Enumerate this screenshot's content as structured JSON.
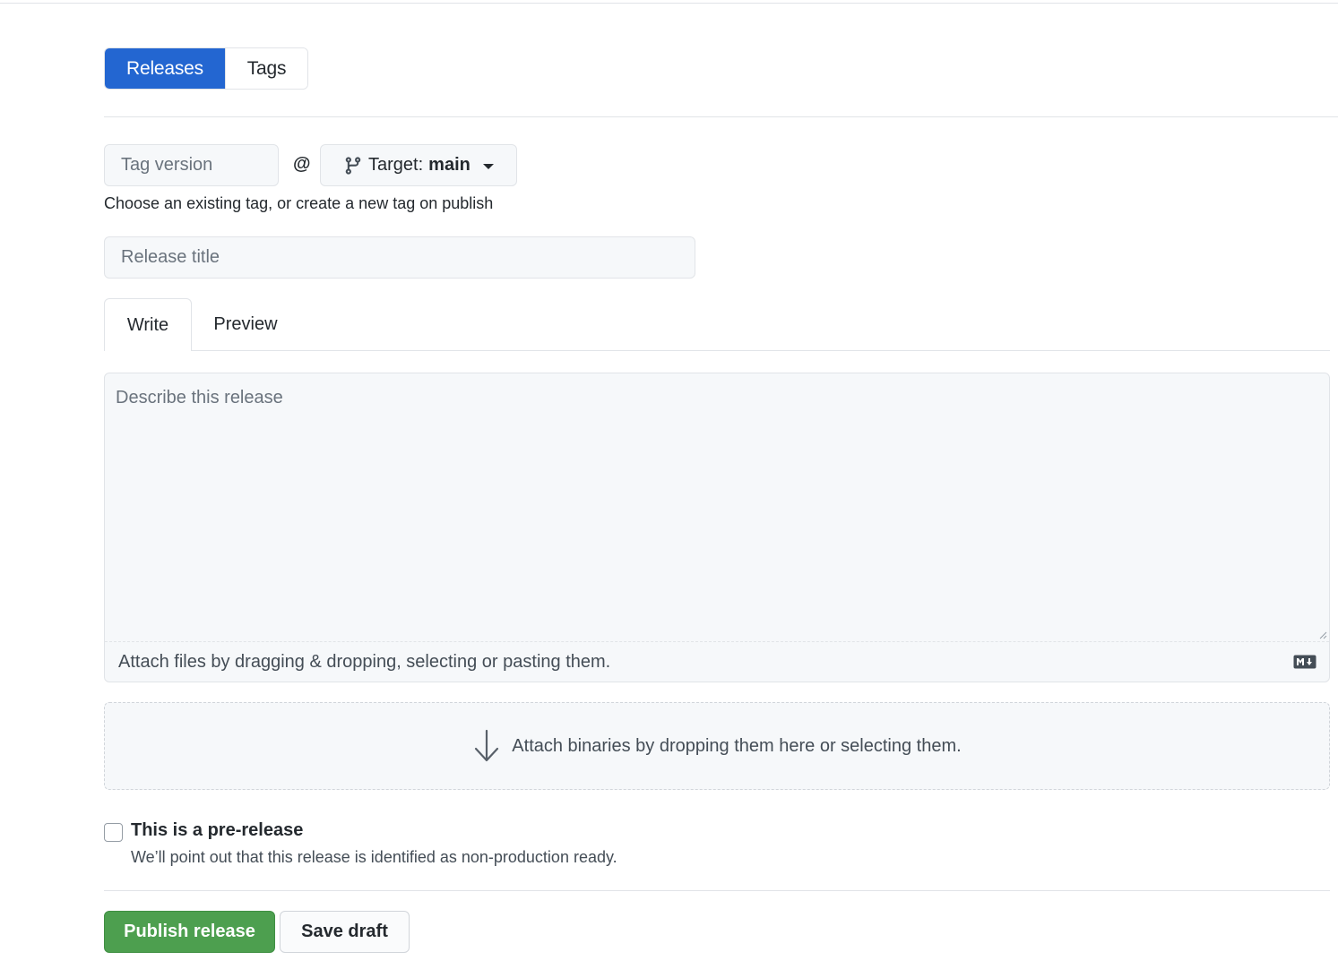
{
  "tabs_top": {
    "releases_label": "Releases",
    "tags_label": "Tags",
    "active": "Releases"
  },
  "tag": {
    "placeholder": "Tag version",
    "value": "",
    "at": "@",
    "target_label": "Target:",
    "target_value": "main",
    "helper": "Choose an existing tag, or create a new tag on publish"
  },
  "title": {
    "placeholder": "Release title",
    "value": ""
  },
  "editor_tabs": {
    "write_label": "Write",
    "preview_label": "Preview",
    "active": "Write"
  },
  "editor": {
    "placeholder": "Describe this release",
    "value": "",
    "attach_text": "Attach files by dragging & dropping, selecting or pasting them.",
    "markdown_icon": "markdown-icon"
  },
  "dropzone": {
    "text": "Attach binaries by dropping them here or selecting them.",
    "icon": "arrow-down-icon"
  },
  "prerelease": {
    "checked": false,
    "label": "This is a pre-release",
    "note": "We’ll point out that this release is identified as non-production ready."
  },
  "actions": {
    "publish_label": "Publish release",
    "draft_label": "Save draft"
  },
  "colors": {
    "primary_blue": "#2366d1",
    "publish_green": "#4d9f4f",
    "border": "#e1e4e8",
    "input_bg": "#f6f8fa"
  }
}
